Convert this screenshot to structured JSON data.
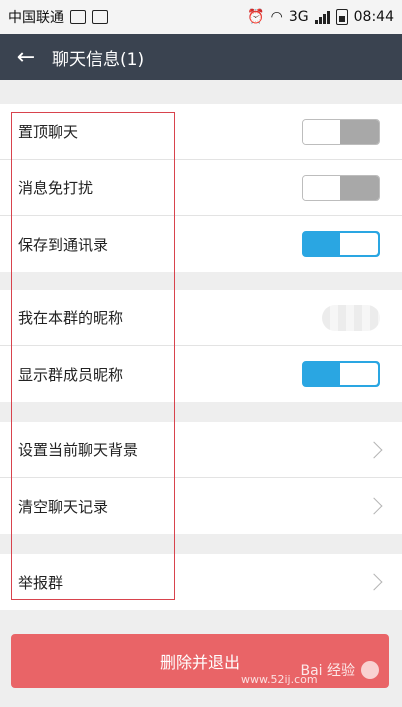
{
  "status_bar": {
    "carrier": "中国联通",
    "network": "3G",
    "time": "08:44"
  },
  "header": {
    "title": "聊天信息(1)"
  },
  "settings": {
    "group1": [
      {
        "label": "置顶聊天",
        "control": "toggle",
        "state": "off"
      },
      {
        "label": "消息免打扰",
        "control": "toggle",
        "state": "off"
      },
      {
        "label": "保存到通讯录",
        "control": "toggle",
        "state": "on"
      }
    ],
    "group2": [
      {
        "label": "我在本群的昵称",
        "control": "value-blurred"
      },
      {
        "label": "显示群成员昵称",
        "control": "toggle",
        "state": "on"
      }
    ],
    "group3": [
      {
        "label": "设置当前聊天背景",
        "control": "chevron"
      },
      {
        "label": "清空聊天记录",
        "control": "chevron"
      }
    ],
    "group4": [
      {
        "label": "举报群",
        "control": "chevron"
      }
    ]
  },
  "danger_button": {
    "label": "删除并退出"
  },
  "watermark": {
    "brand": "Bai 经验",
    "site": "www.52ij.com"
  },
  "colors": {
    "app_bar": "#3a4350",
    "toggle_on": "#2aa6e2",
    "toggle_off": "#a8a8a8",
    "danger": "#e96467",
    "highlight": "#d8434d"
  }
}
